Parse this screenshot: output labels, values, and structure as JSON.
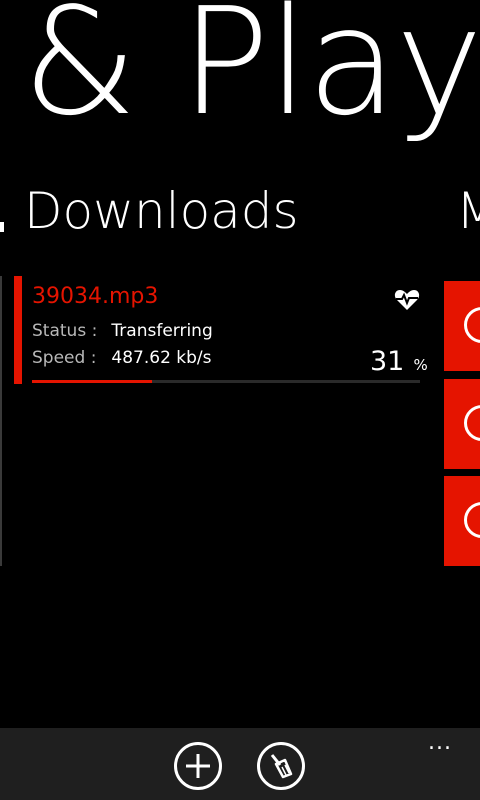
{
  "header": {
    "app_title": "& Play",
    "section_title": "Downloads",
    "next_section_title": "M"
  },
  "download": {
    "file_name": "39034.mp3",
    "status_label": "Status :",
    "status_value": "Transferring",
    "speed_label": "Speed :",
    "speed_value": "487.62 kb/s",
    "progress_percent": 31,
    "progress_text": "31",
    "percent_symbol": "%",
    "icon": "heart-pulse-icon"
  },
  "side_tiles": [
    "power-icon",
    "gauge-icon",
    "info-icon"
  ],
  "app_bar": {
    "buttons": [
      "add-icon",
      "broom-icon"
    ],
    "more_label": "..."
  },
  "colors": {
    "accent": "#e51400",
    "background": "#000000",
    "app_bar": "#1f1f1f"
  }
}
